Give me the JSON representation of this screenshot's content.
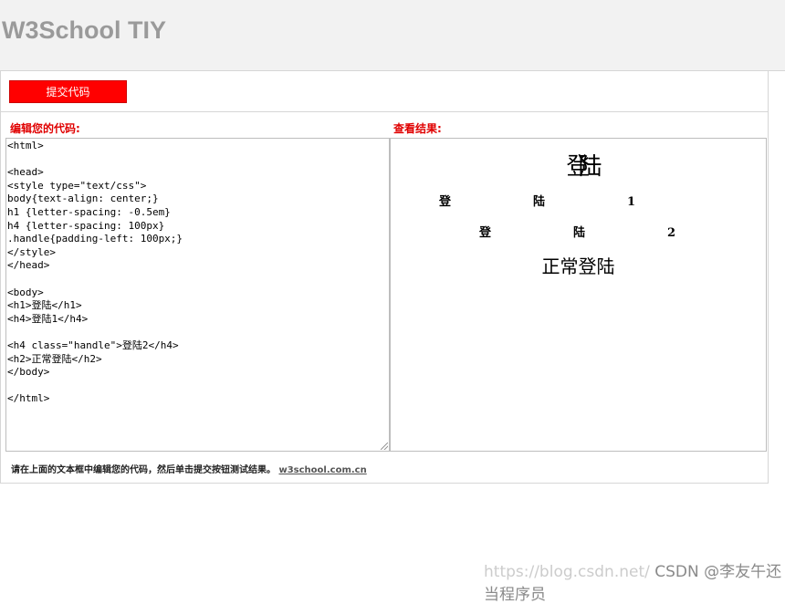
{
  "header": {
    "title": "W3School TIY"
  },
  "toolbar": {
    "submit_label": "提交代码"
  },
  "labels": {
    "edit": "编辑您的代码:",
    "result": "查看结果:"
  },
  "editor": {
    "code": "<html>\n\n<head>\n<style type=\"text/css\">\nbody{text-align: center;}\nh1 {letter-spacing: -0.5em}\nh4 {letter-spacing: 100px}\n.handle{padding-left: 100px;}\n</style>\n</head>\n\n<body>\n<h1>登陆</h1>\n<h4>登陆1</h4>\n\n<h4 class=\"handle\">登陆2</h4>\n<h2>正常登陆</h2>\n</body>\n\n</html>"
  },
  "result": {
    "h1": "登陆",
    "h4_first": "登陆1",
    "h4_second": "登陆2",
    "h2": "正常登陆"
  },
  "footer": {
    "note": "请在上面的文本框中编辑您的代码，然后单击提交按钮测试结果。",
    "link": "w3school.com.cn"
  },
  "watermark": {
    "url": "https://blog.csdn.net/",
    "brand": "CSDN @李友午还当程序员"
  }
}
